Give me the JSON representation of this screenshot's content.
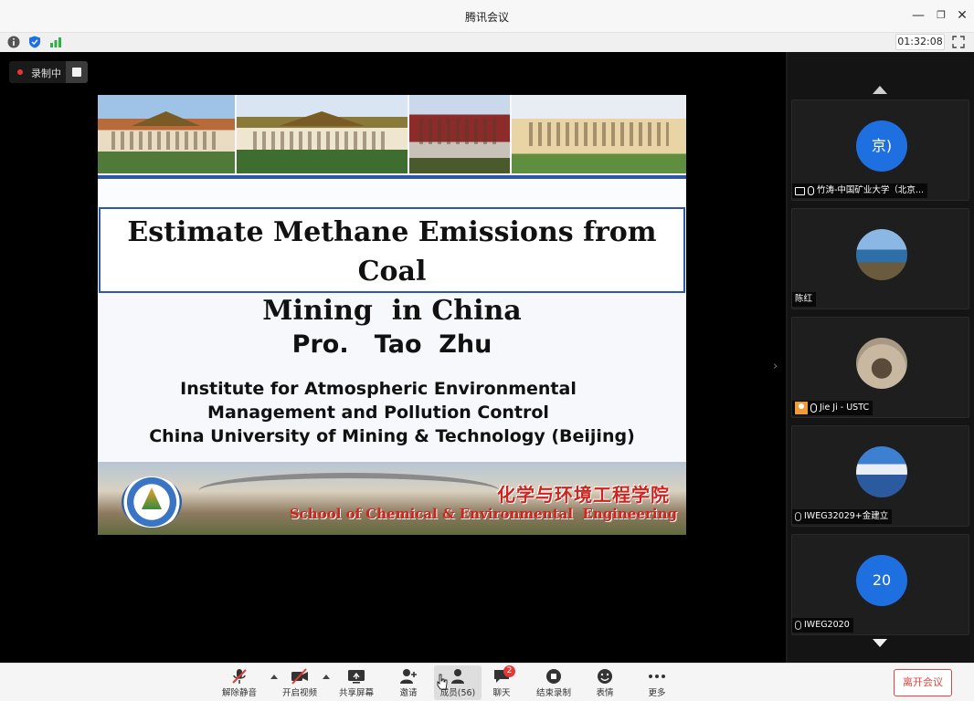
{
  "window": {
    "title": "腾讯会议"
  },
  "infobar": {
    "timer": "01:32:08"
  },
  "recording": {
    "label": "录制中"
  },
  "slide": {
    "title_line1": "Estimate Methane Emissions from Coal",
    "title_line2": "Mining  in China",
    "presenter": "Pro.   Tao  Zhu",
    "affiliation_line1": "Institute for Atmospheric Environmental",
    "affiliation_line2": "Management and Pollution Control",
    "affiliation_line3": "China University of Mining & Technology (Beijing)",
    "banner_cn": "化学与环境工程学院",
    "banner_en": "School of Chemical & Environmental  Engineering"
  },
  "participants": [
    {
      "name": "竹涛-中国矿业大学（北京...",
      "avatar_text": "京)",
      "avatar_kind": "text",
      "sharing": true,
      "mic": "on"
    },
    {
      "name": "陈红",
      "avatar_kind": "sea",
      "sharing": false,
      "mic": "none"
    },
    {
      "name": "Jie Ji - USTC",
      "avatar_kind": "room",
      "host": true,
      "mic": "on"
    },
    {
      "name": "IWEG32029+金建立",
      "avatar_kind": "mountain",
      "mic": "off"
    },
    {
      "name": "IWEG2020",
      "avatar_text": "20",
      "avatar_kind": "text",
      "mic": "off"
    }
  ],
  "toolbar": {
    "unmute": "解除静音",
    "video": "开启视频",
    "share": "共享屏幕",
    "invite": "邀请",
    "members": "成员(56)",
    "chat": "聊天",
    "chat_badge": "2",
    "end_record": "结束录制",
    "reactions": "表情",
    "more": "更多",
    "leave": "离开会议"
  },
  "colors": {
    "accent_blue": "#1e6fe0",
    "danger_red": "#e0463f",
    "slide_blue": "#2f57a4"
  }
}
